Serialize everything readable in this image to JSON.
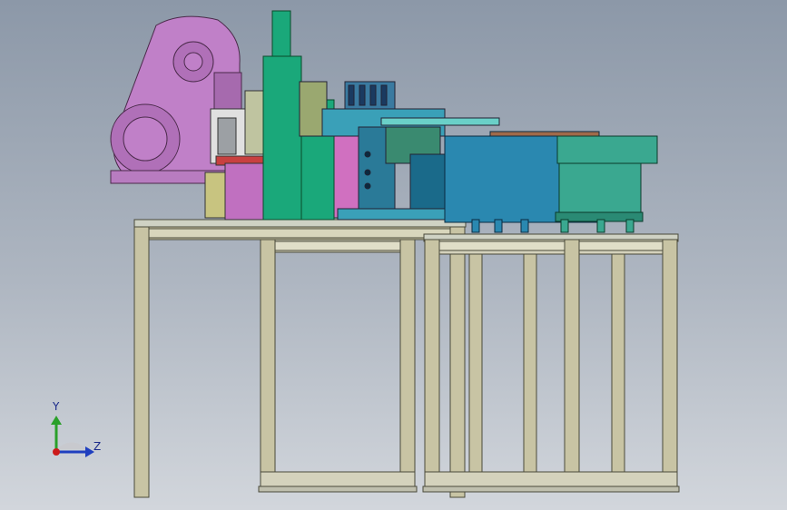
{
  "viewport": {
    "background_top": "#8c98a8",
    "background_bottom": "#d2d6dc"
  },
  "triad": {
    "y_label": "Y",
    "z_label": "Z",
    "y_color": "#2aa02a",
    "z_color": "#1f3fbf",
    "origin_color": "#cc1a1a"
  },
  "colors": {
    "motor_housing": "#c080c8",
    "frame_tan": "#c8c4a4",
    "frame_light": "#dcdcc4",
    "column_green": "#1aa87a",
    "tool_blue": "#3aa0b8",
    "bowl_blue": "#2a88b0",
    "bowl_teal": "#3aa890",
    "base_brown": "#a06a4a"
  }
}
